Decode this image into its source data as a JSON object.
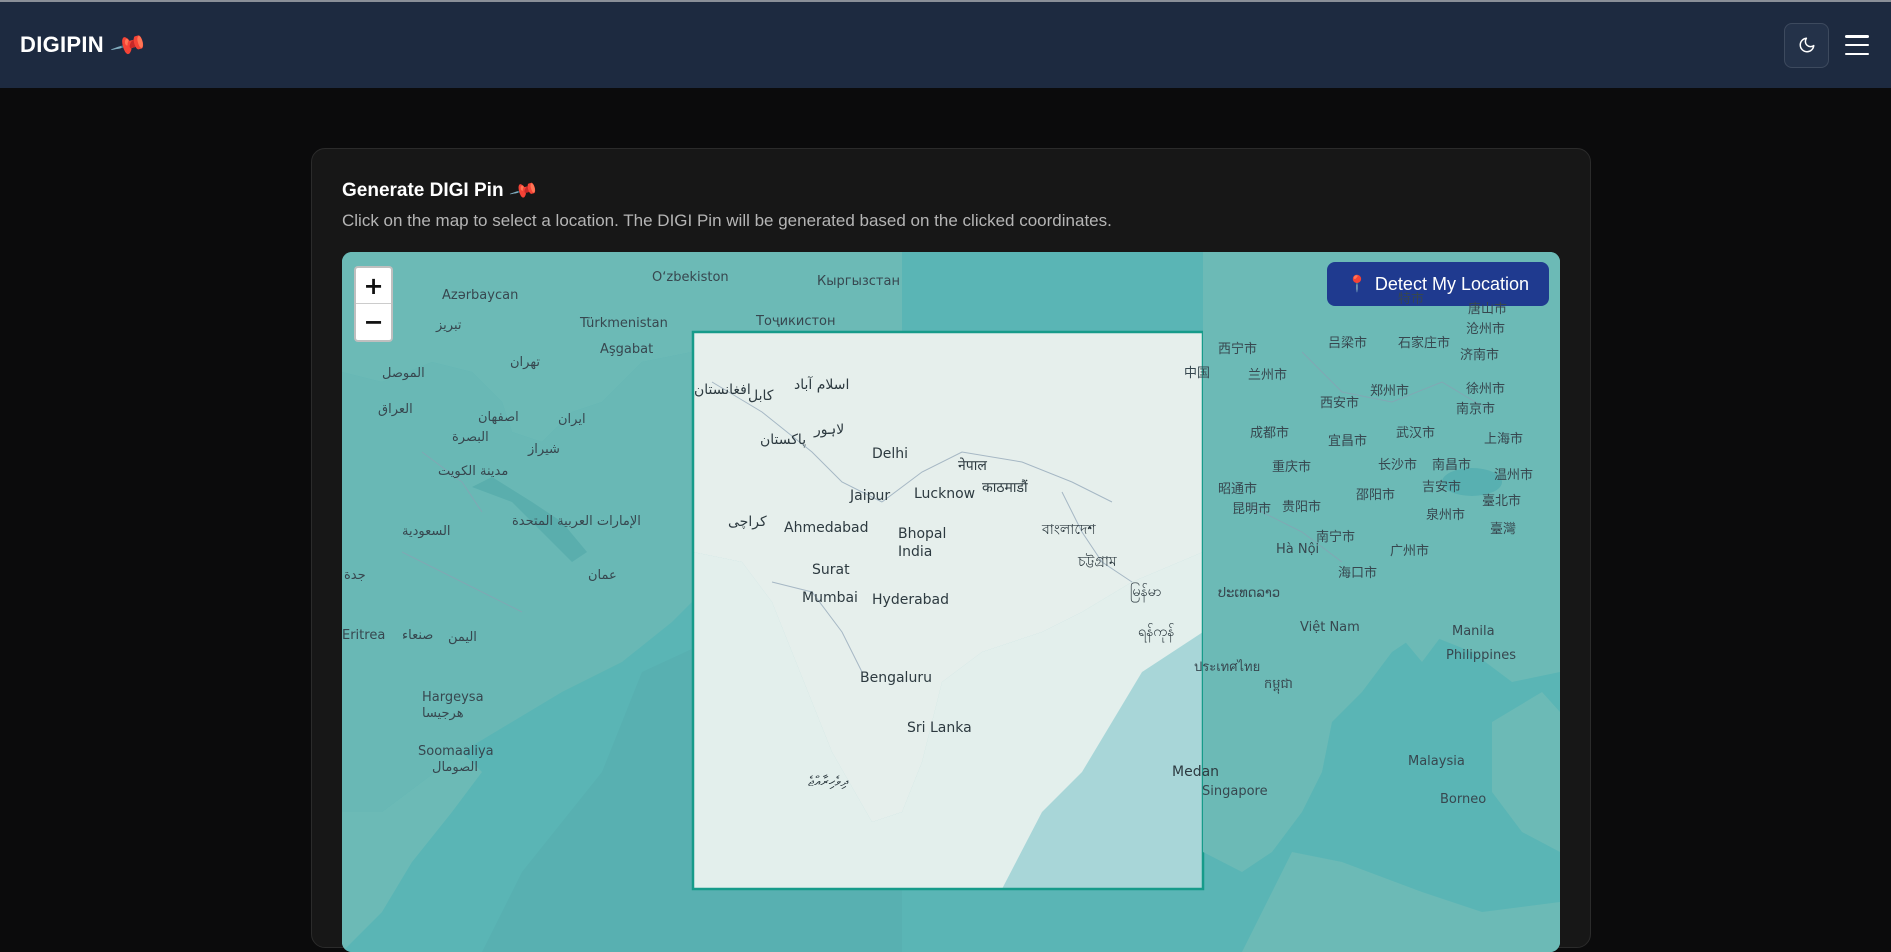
{
  "navbar": {
    "brand": "DIGIPIN",
    "brand_icon": "pushpin-icon",
    "theme_toggle_icon": "moon-icon",
    "menu_icon": "hamburger-menu-icon"
  },
  "card": {
    "title": "Generate DIGI Pin",
    "title_icon": "pushpin-icon",
    "description": "Click on the map to select a location. The DIGI Pin will be generated based on the clicked coordinates."
  },
  "map": {
    "zoom_in_label": "+",
    "zoom_out_label": "−",
    "detect_button_label": "Detect My Location",
    "detect_button_icon": "round-pushpin-icon",
    "labels": {
      "azerbaycan": "Azərbaycan",
      "uzbekiston": "Oʻzbekiston",
      "kyrgyzstan": "Кыргызстан",
      "turkmenistan": "Türkmenistan",
      "ashgabat": "Aşgabat",
      "tajikistan": "Тоҷикистон",
      "tabriz": "تبریز",
      "tehran": "تهران",
      "mosul": "الموصل",
      "iraq": "العراق",
      "isfahan": "اصفهان",
      "iran": "ایران",
      "basra": "البصرة",
      "shiraz": "شیراز",
      "kuwait": "مدينة الكويت",
      "saudi": "السعودية",
      "uae": "الإمارات العربية المتحدة",
      "oman": "عمان",
      "jeddah": "جدة",
      "sanaa": "صنعاء",
      "yemen": "اليمن",
      "eritrea": "Eritrea",
      "hargeysa": "Hargeysa",
      "hargeysa_ar": "هرجيسا",
      "somaliland": "Soomaaliya",
      "somaliland_ar": "الصومال",
      "kabul": "کابل",
      "islamabad": "اسلام آباد",
      "afghanistan": "افغانستان",
      "lahore": "لاہور",
      "pakistan": "پاکستان",
      "karachi": "کراچی",
      "delhi": "Delhi",
      "nepal": "नेपाल",
      "kathmandu": "काठमाडौं",
      "jaipur": "Jaipur",
      "lucknow": "Lucknow",
      "ahmedabad": "Ahmedabad",
      "bhopal": "Bhopal",
      "india": "India",
      "bangladesh": "বাংলাদেশ",
      "chittagong": "চট্টগ্রাম",
      "surat": "Surat",
      "mumbai": "Mumbai",
      "hyderabad": "Hyderabad",
      "myanmar": "မြန်မာ",
      "yangon": "ရန်ကုန်",
      "bengaluru": "Bengaluru",
      "srilanka": "Sri Lanka",
      "maldives": "ދިވެހިރާއްޖެ",
      "medan": "Medan",
      "china": "中国",
      "xining": "西宁市",
      "lanzhou": "兰州市",
      "xian": "西安市",
      "chengdu": "成都市",
      "chongqing": "重庆市",
      "kunming": "昆明市",
      "guiyang": "贵阳市",
      "zhaotong": "昭通市",
      "yibin": "宜昌市",
      "wuhan": "武汉市",
      "changsha": "长沙市",
      "shaoyang": "邵阳市",
      "nanning": "南宁市",
      "guangzhou": "广州市",
      "haikou": "海口市",
      "zhengzhou": "郑州市",
      "luliang": "吕梁市",
      "shijiazhuang": "石家庄市",
      "jinan": "济南市",
      "tianjin": "特市",
      "tangshan": "唐山市",
      "cangzhou": "沧州市",
      "xuzhou": "徐州市",
      "nanjing": "南京市",
      "shanghai": "上海市",
      "nanchang": "南昌市",
      "jian": "吉安市",
      "wenzhou": "温州市",
      "taibei": "臺北市",
      "taiwan": "臺灣",
      "quanzhou": "泉州市",
      "hanoi": "Hà Nội",
      "laos": "ປະເທດລາວ",
      "vietnam": "Việt Nam",
      "thailand": "ประเทศไทย",
      "cambodia": "កម្ពុជា",
      "manila": "Manila",
      "philippines": "Philippines",
      "malaysia": "Malaysia",
      "singapore": "Singapore",
      "borneo": "Borneo"
    }
  }
}
